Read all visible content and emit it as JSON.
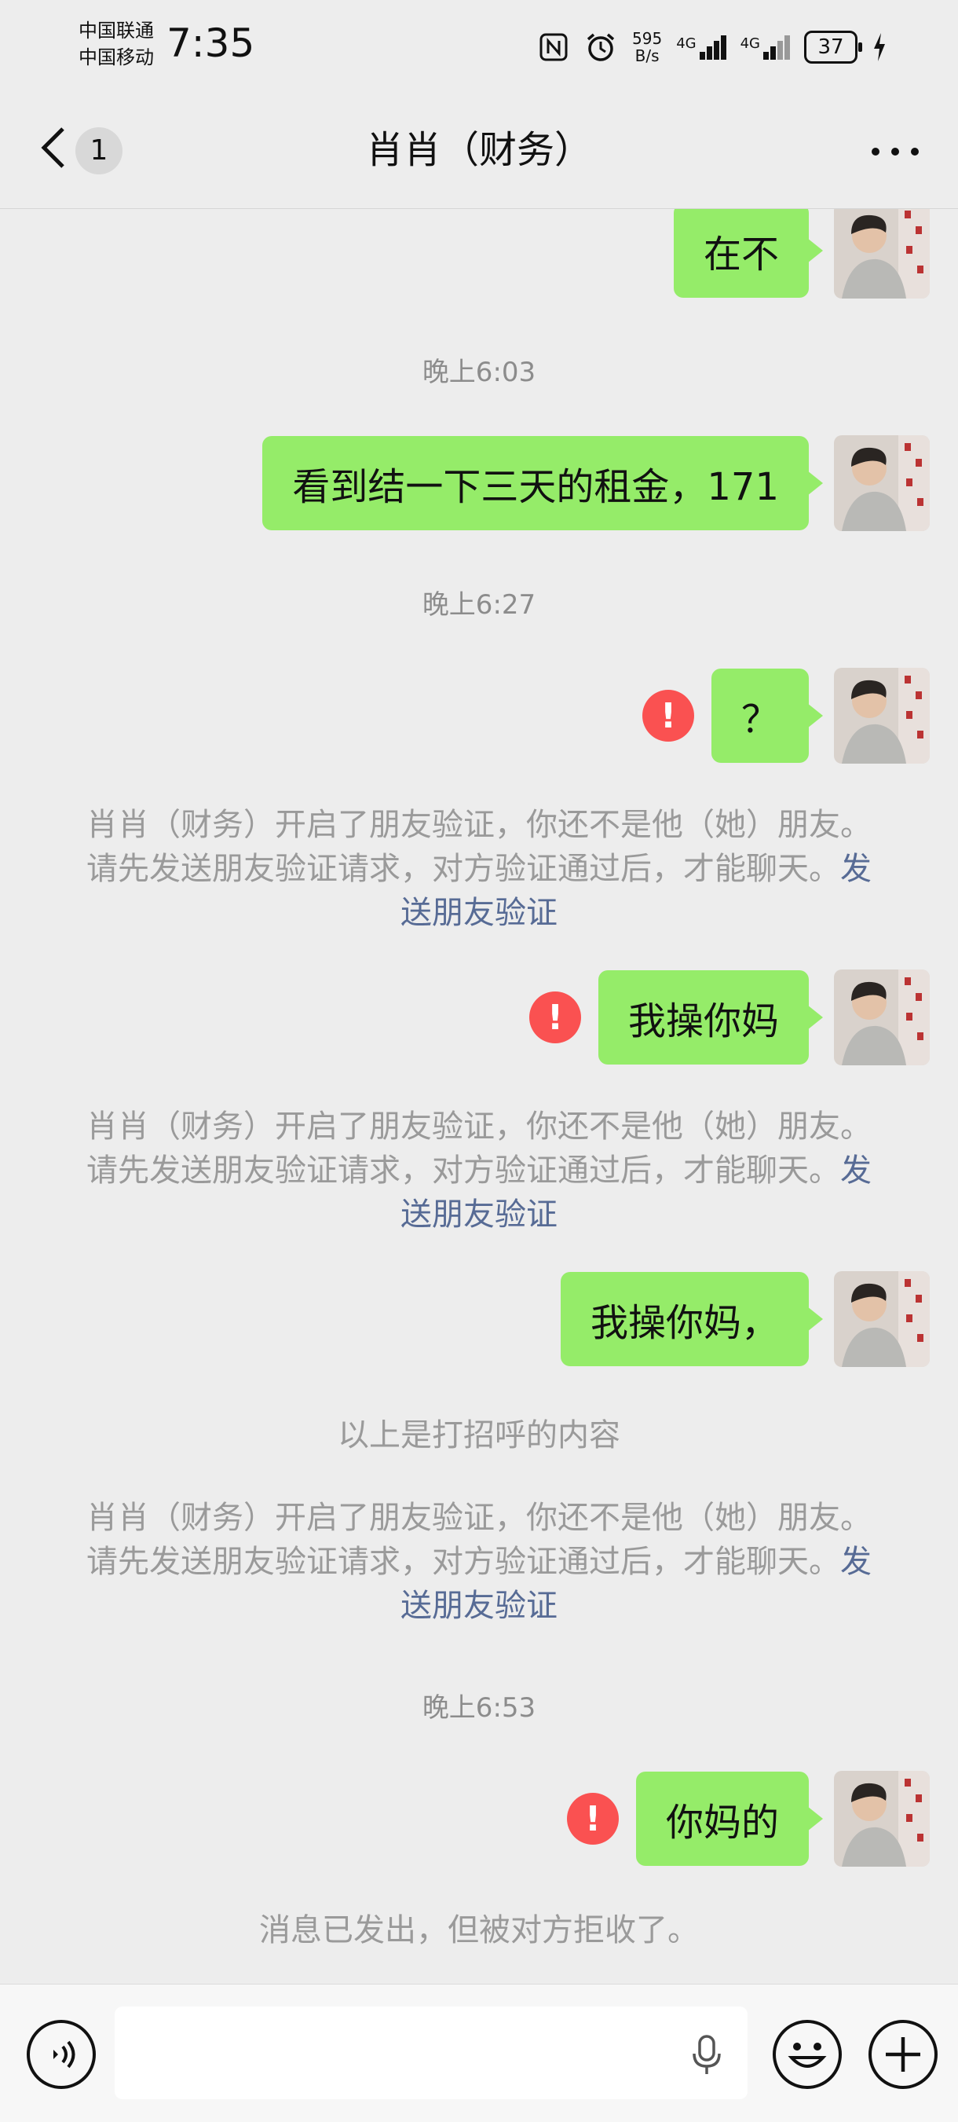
{
  "status_bar": {
    "carrier1": "中国联通",
    "carrier2": "中国移动",
    "time": "7:35",
    "speed_value": "595",
    "speed_unit": "B/s",
    "net1": "4G",
    "net2": "4G",
    "battery": "37"
  },
  "nav": {
    "unread_badge": "1",
    "title": "肖肖（财务）"
  },
  "messages": {
    "m1": "在不",
    "t1": "晚上6:03",
    "m2": "看到结一下三天的租金，171",
    "t2": "晚上6:27",
    "m3": "？",
    "sys1_text": "肖肖（财务）开启了朋友验证，你还不是他（她）朋友。请先发送朋友验证请求，对方验证通过后，才能聊天。",
    "sys1_link": "发送朋友验证",
    "m4": "我操你妈",
    "sys2_text": "肖肖（财务）开启了朋友验证，你还不是他（她）朋友。请先发送朋友验证请求，对方验证通过后，才能聊天。",
    "sys2_link": "发送朋友验证",
    "m5": "我操你妈，",
    "greeting_note": "以上是打招呼的内容",
    "sys3_text": "肖肖（财务）开启了朋友验证，你还不是他（她）朋友。请先发送朋友验证请求，对方验证通过后，才能聊天。",
    "sys3_link": "发送朋友验证",
    "t3": "晚上6:53",
    "m6": "你妈的",
    "rejected_note": "消息已发出，但被对方拒收了。",
    "error_mark": "!"
  },
  "colors": {
    "bubble_green": "#95ec69",
    "error_red": "#fa5151",
    "link_blue": "#576b95",
    "chat_bg": "#ededed"
  },
  "icons": [
    "nfc-icon",
    "alarm-icon",
    "signal-icon",
    "battery-icon",
    "charging-icon",
    "back-chevron-icon",
    "more-icon",
    "voice-icon",
    "mic-icon",
    "emoji-icon",
    "plus-icon",
    "error-icon"
  ]
}
